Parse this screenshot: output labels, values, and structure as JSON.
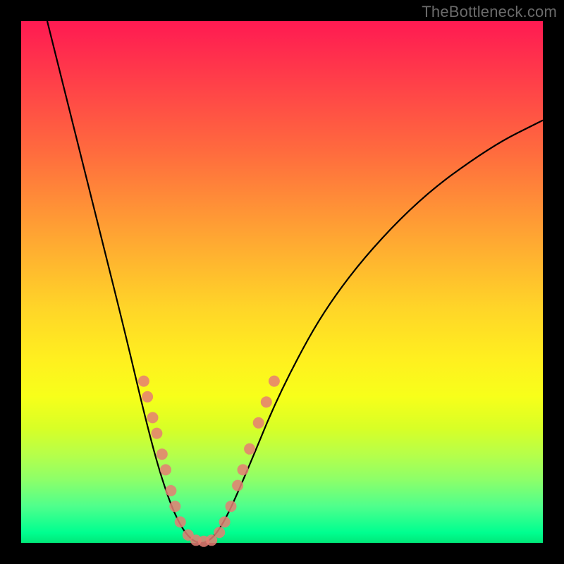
{
  "watermark": "TheBottleneck.com",
  "chart_data": {
    "type": "line",
    "title": "",
    "xlabel": "",
    "ylabel": "",
    "xlim": [
      0,
      100
    ],
    "ylim": [
      0,
      100
    ],
    "curve_points": [
      {
        "x": 5,
        "y": 100
      },
      {
        "x": 10,
        "y": 80
      },
      {
        "x": 15,
        "y": 60
      },
      {
        "x": 20,
        "y": 40
      },
      {
        "x": 24,
        "y": 23
      },
      {
        "x": 27,
        "y": 12
      },
      {
        "x": 30,
        "y": 4
      },
      {
        "x": 33,
        "y": 0
      },
      {
        "x": 36,
        "y": 0
      },
      {
        "x": 39,
        "y": 4
      },
      {
        "x": 43,
        "y": 13
      },
      {
        "x": 50,
        "y": 30
      },
      {
        "x": 60,
        "y": 48
      },
      {
        "x": 75,
        "y": 65
      },
      {
        "x": 90,
        "y": 76
      },
      {
        "x": 100,
        "y": 81
      }
    ],
    "markers_left": [
      {
        "x": 23.5,
        "y": 31
      },
      {
        "x": 24.2,
        "y": 28
      },
      {
        "x": 25.2,
        "y": 24
      },
      {
        "x": 26.0,
        "y": 21
      },
      {
        "x": 27.0,
        "y": 17
      },
      {
        "x": 27.7,
        "y": 14
      },
      {
        "x": 28.7,
        "y": 10
      },
      {
        "x": 29.5,
        "y": 7
      },
      {
        "x": 30.5,
        "y": 4
      },
      {
        "x": 32.0,
        "y": 1.5
      }
    ],
    "markers_bottom": [
      {
        "x": 33.5,
        "y": 0.5
      },
      {
        "x": 35.0,
        "y": 0.3
      },
      {
        "x": 36.5,
        "y": 0.5
      }
    ],
    "markers_right": [
      {
        "x": 38.0,
        "y": 2
      },
      {
        "x": 39.0,
        "y": 4
      },
      {
        "x": 40.2,
        "y": 7
      },
      {
        "x": 41.5,
        "y": 11
      },
      {
        "x": 42.5,
        "y": 14
      },
      {
        "x": 43.8,
        "y": 18
      },
      {
        "x": 45.5,
        "y": 23
      },
      {
        "x": 47.0,
        "y": 27
      },
      {
        "x": 48.5,
        "y": 31
      }
    ],
    "marker_color": "#e57e73",
    "curve_color": "#000000"
  }
}
